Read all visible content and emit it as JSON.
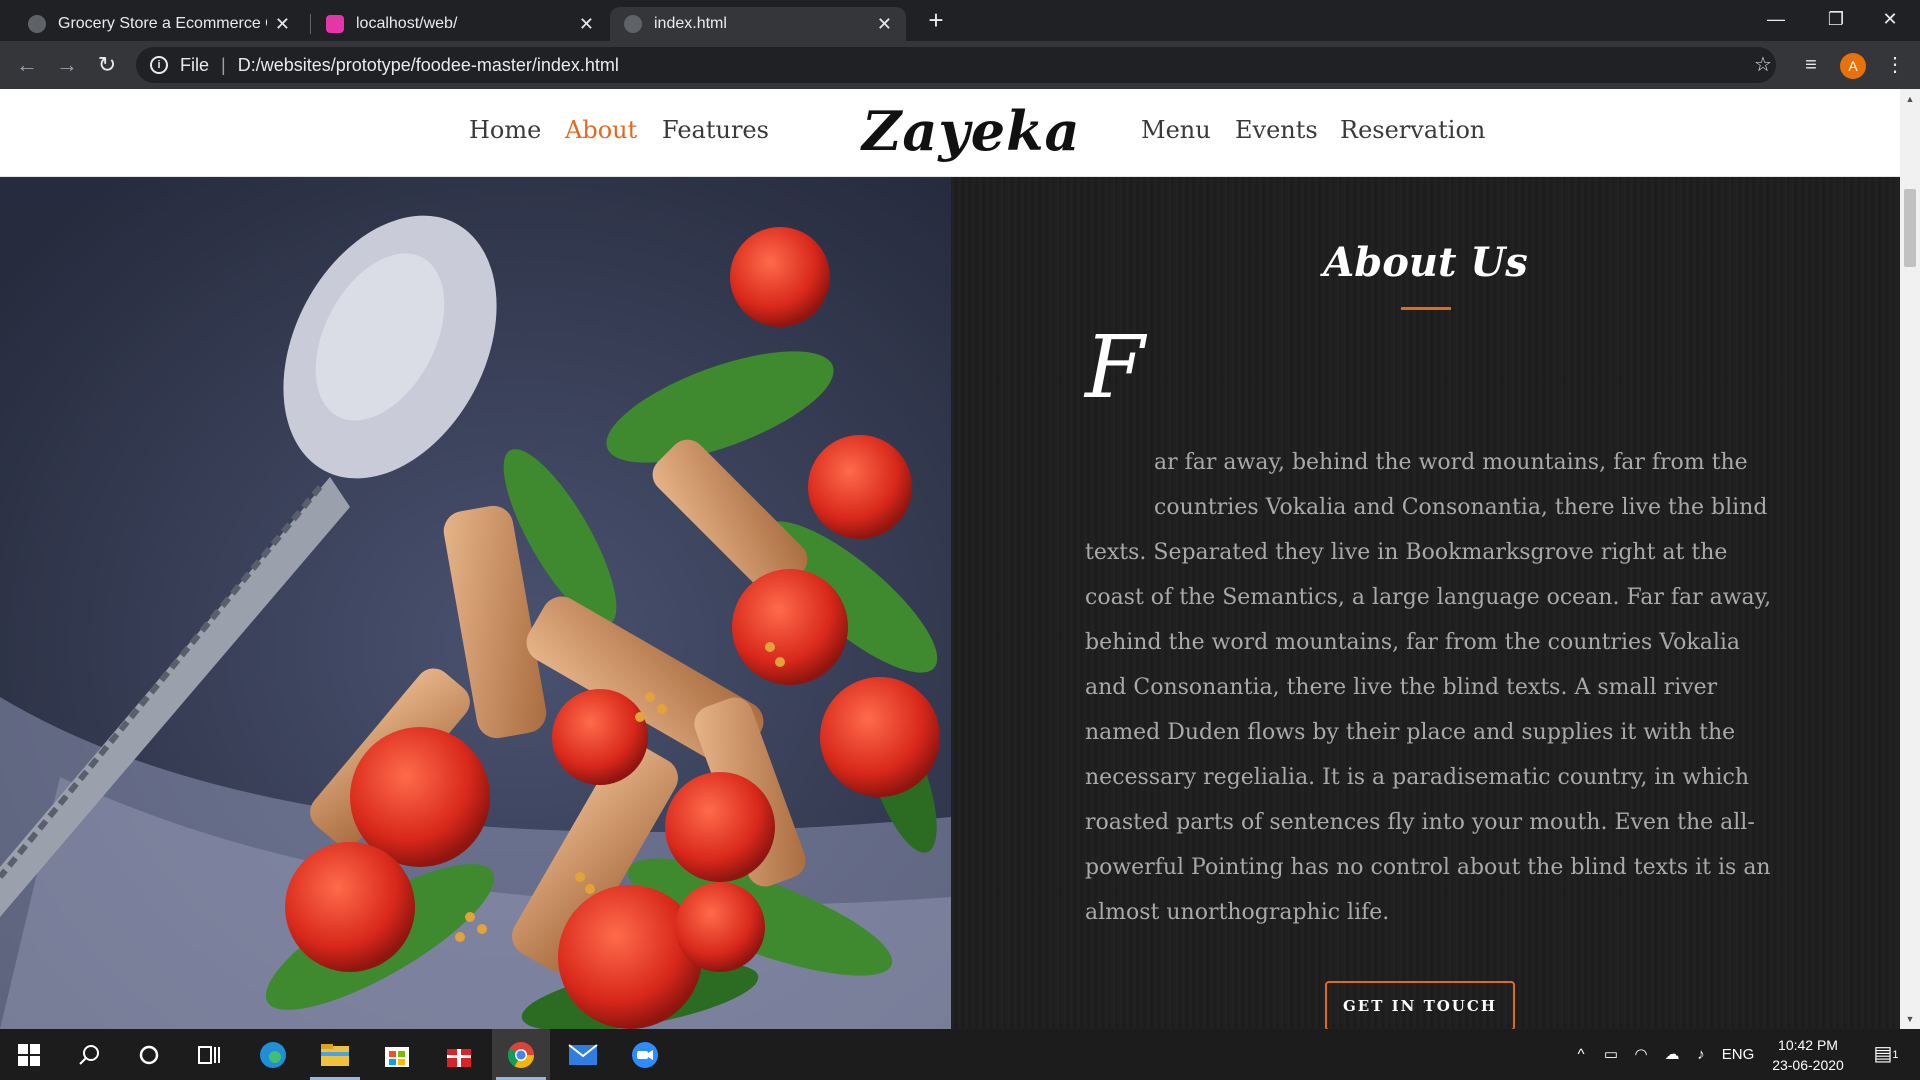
{
  "browser": {
    "tabs": [
      {
        "title": "Grocery Store a Ecommerce Onli",
        "active": false
      },
      {
        "title": "localhost/web/",
        "active": false
      },
      {
        "title": "index.html",
        "active": true
      }
    ],
    "new_tab": "+",
    "window_controls": {
      "minimize": "—",
      "restore": "❐",
      "close": "✕"
    },
    "nav": {
      "back": "←",
      "forward": "→",
      "reload": "↻"
    },
    "address": {
      "info": "i",
      "scheme": "File",
      "separator": "|",
      "url": "D:/websites/prototype/foodee-master/index.html"
    },
    "bookmark": "☆",
    "media": "≡",
    "profile_initial": "A",
    "menu": "⋮"
  },
  "site": {
    "nav_left": [
      "Home",
      "About",
      "Features"
    ],
    "logo": "Zayeka",
    "nav_right": [
      "Menu",
      "Events",
      "Reservation"
    ],
    "active_nav": "About",
    "about": {
      "title": "About Us",
      "dropcap": "F",
      "lines": [
        "ar far away, behind the word mountains, far from the",
        "countries Vokalia and Consonantia, there live the blind",
        "texts. Separated they live in Bookmarksgrove right at the",
        "coast of the Semantics, a large language ocean. Far far away,",
        "behind the word mountains, far from the countries Vokalia",
        "and Consonantia, there live the blind texts. A small river",
        "named Duden flows by their place and supplies it with the",
        "necessary regelialia. It is a paradisematic country, in which",
        "roasted parts of sentences fly into your mouth. Even the all-",
        "powerful Pointing has no control about the blind texts it is an",
        "almost unorthographic life."
      ],
      "cta": "GET IN TOUCH"
    },
    "accent_color": "#e06a1f"
  },
  "taskbar": {
    "language": "ENG",
    "time": "10:42 PM",
    "date": "23-06-2020",
    "notifications": "1",
    "tray_caret": "^"
  }
}
